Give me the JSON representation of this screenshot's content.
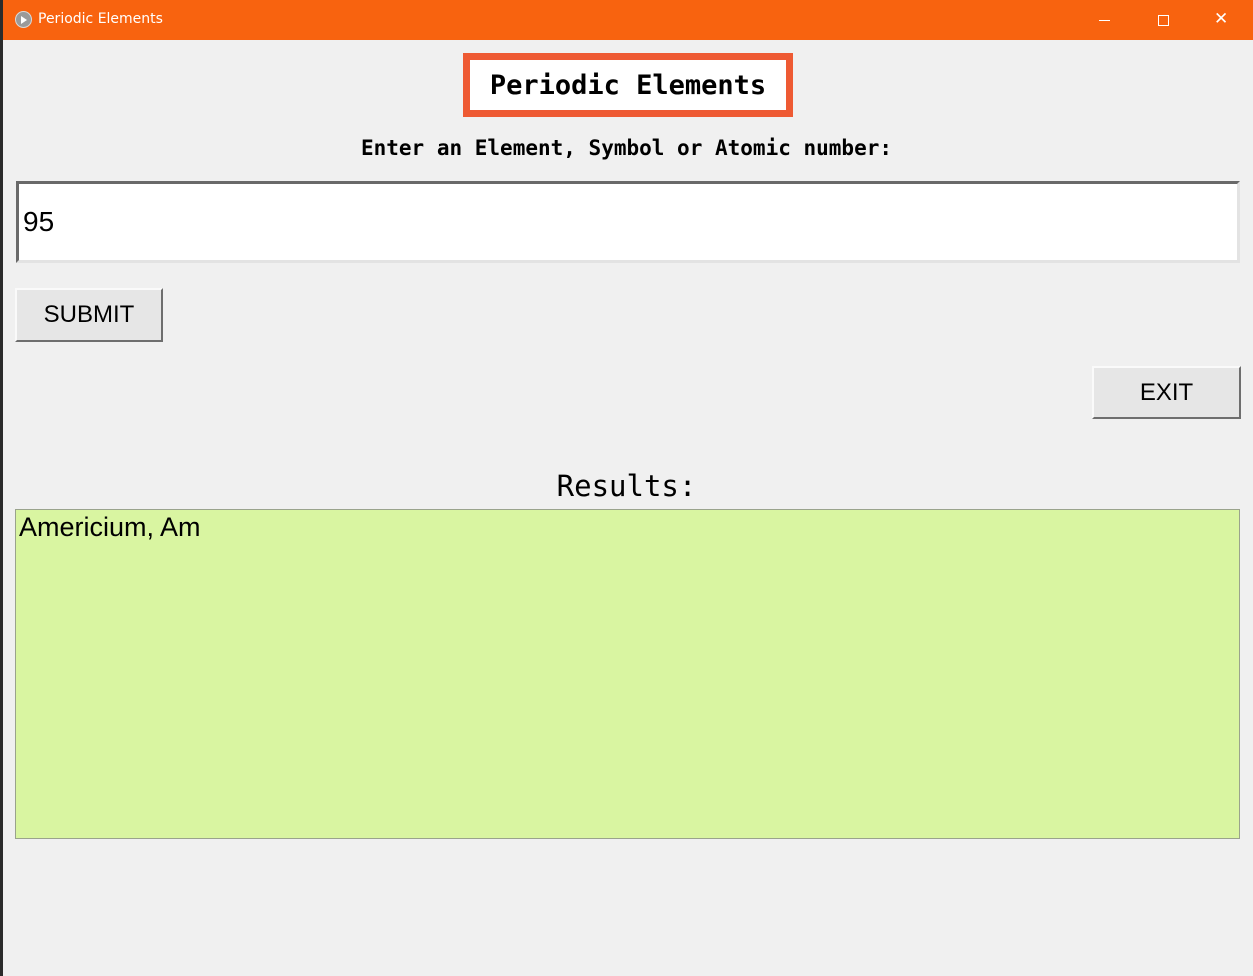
{
  "window": {
    "title": "Periodic Elements",
    "accent_color": "#f8630f",
    "controls": {
      "minimize_icon": "minimize-icon",
      "maximize_icon": "maximize-icon",
      "close_icon": "close-icon",
      "close_glyph": "✕"
    }
  },
  "app": {
    "heading": "Periodic Elements",
    "heading_border_color": "#ee5a33",
    "prompt": "Enter an Element, Symbol or Atomic number:",
    "input": {
      "value": "95",
      "placeholder": ""
    },
    "submit_label": "SUBMIT",
    "exit_label": "EXIT",
    "results_label": "Results:",
    "results_text": "Americium, Am",
    "results_bg_color": "#d9f5a1"
  }
}
